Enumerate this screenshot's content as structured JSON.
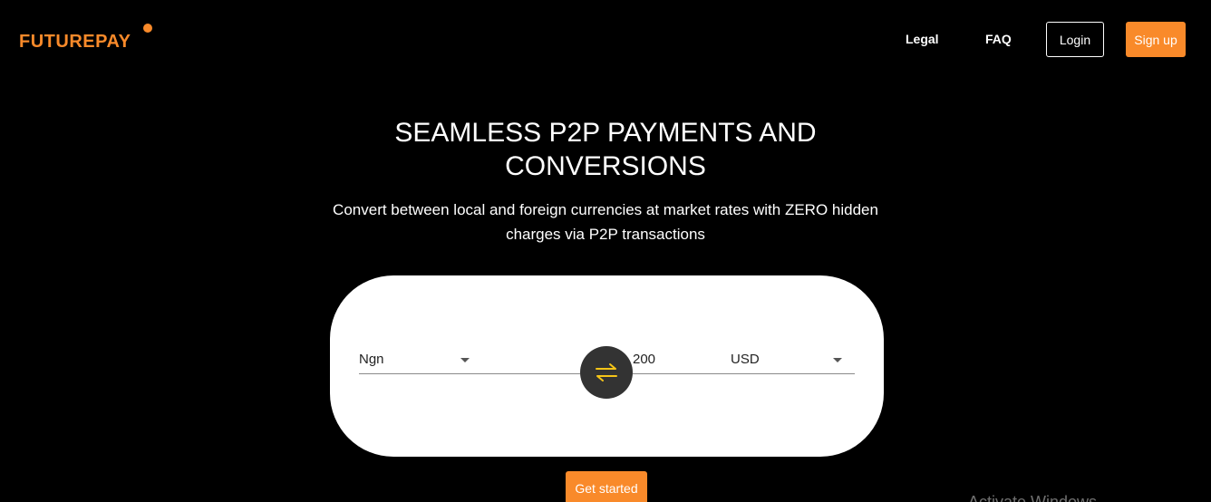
{
  "brand": {
    "name": "FUTUREPAY",
    "accent_color": "#f98a2a"
  },
  "nav": {
    "legal": "Legal",
    "faq": "FAQ",
    "login": "Login",
    "signup": "Sign up"
  },
  "hero": {
    "title_line1": "SEAMLESS P2P PAYMENTS AND",
    "title_line2": "CONVERSIONS",
    "subtitle_line1": "Convert between local and foreign currencies at market rates with ZERO hidden",
    "subtitle_line2": "charges via P2P transactions"
  },
  "converter": {
    "from_currency": "Ngn",
    "amount": "200",
    "to_currency": "USD",
    "swap_icon": "swap-arrows-icon",
    "swap_icon_color": "#f5c518"
  },
  "cta": {
    "get_started": "Get started"
  },
  "overlay": {
    "watermark": "Activate Windows"
  }
}
